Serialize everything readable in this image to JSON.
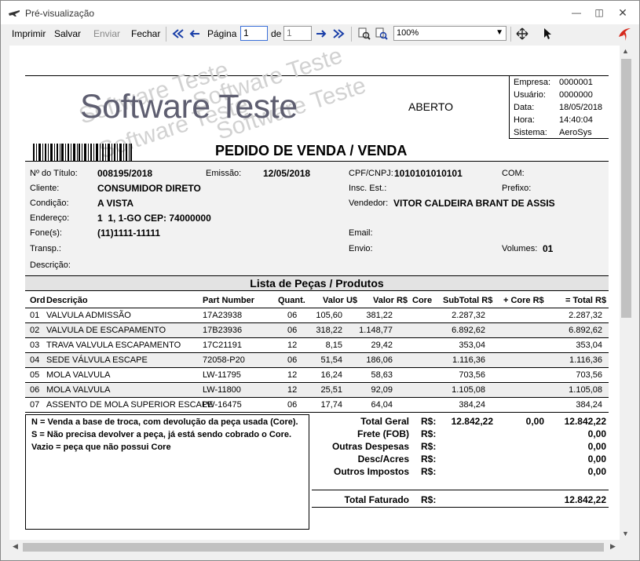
{
  "window": {
    "title": "Pré-visualização"
  },
  "toolbar": {
    "print": "Imprimir",
    "save": "Salvar",
    "send": "Enviar",
    "close": "Fechar",
    "page_label": "Página",
    "page_value": "1",
    "of_label": "de",
    "page_total": "1",
    "zoom": "100%"
  },
  "report": {
    "watermark": "Software Teste",
    "logo": "Software Teste",
    "status": "ABERTO",
    "info": [
      {
        "label": "Empresa:",
        "value": "0000001"
      },
      {
        "label": "Usuário:",
        "value": "0000000"
      },
      {
        "label": "Data:",
        "value": "18/05/2018"
      },
      {
        "label": "Hora:",
        "value": "14:40:04"
      },
      {
        "label": "Sistema:",
        "value": "AeroSys"
      }
    ],
    "title": "PEDIDO DE VENDA / VENDA",
    "fields": {
      "titulo_label": "Nº do Título:",
      "titulo": "008195/2018",
      "emissao_label": "Emissão:",
      "emissao": "12/05/2018",
      "cpf_label": "CPF/CNPJ:",
      "cpf": "1010101010101",
      "com_label": "COM:",
      "cliente_label": "Cliente:",
      "cliente": "CONSUMIDOR DIRETO",
      "insc_label": "Insc. Est.:",
      "prefixo_label": "Prefixo:",
      "condicao_label": "Condição:",
      "condicao": "A VISTA",
      "vendedor_label": "Vendedor:",
      "vendedor": "VITOR CALDEIRA BRANT DE ASSIS",
      "endereco_label": "Endereço:",
      "endereco": "1  1, 1-GO CEP: 74000000",
      "fone_label": "Fone(s):",
      "fone": "(11)1111-11111",
      "email_label": "Email:",
      "transp_label": "Transp.:",
      "envio_label": "Envio:",
      "volumes_label": "Volumes:",
      "volumes": "01",
      "descricao_label": "Descrição:"
    },
    "section_title": "Lista de Peças / Produtos",
    "columns": [
      "Ord",
      "Descrição",
      "Part Number",
      "Quant.",
      "Valor U$",
      "Valor R$",
      "Core",
      "SubTotal R$",
      "+ Core R$",
      "= Total R$"
    ],
    "rows": [
      {
        "ord": "01",
        "desc": "VALVULA ADMISSÃO",
        "pn": "17A23938",
        "qty": "06",
        "vu": "105,60",
        "vr": "381,22",
        "core": "",
        "sub": "2.287,32",
        "pcore": "",
        "total": "2.287,32"
      },
      {
        "ord": "02",
        "desc": "VALVULA DE ESCAPAMENTO",
        "pn": "17B23936",
        "qty": "06",
        "vu": "318,22",
        "vr": "1.148,77",
        "core": "",
        "sub": "6.892,62",
        "pcore": "",
        "total": "6.892,62"
      },
      {
        "ord": "03",
        "desc": "TRAVA VALVULA ESCAPAMENTO",
        "pn": "17C21191",
        "qty": "12",
        "vu": "8,15",
        "vr": "29,42",
        "core": "",
        "sub": "353,04",
        "pcore": "",
        "total": "353,04"
      },
      {
        "ord": "04",
        "desc": "SEDE VÁLVULA ESCAPE",
        "pn": "72058-P20",
        "qty": "06",
        "vu": "51,54",
        "vr": "186,06",
        "core": "",
        "sub": "1.116,36",
        "pcore": "",
        "total": "1.116,36"
      },
      {
        "ord": "05",
        "desc": "MOLA VALVULA",
        "pn": "LW-11795",
        "qty": "12",
        "vu": "16,24",
        "vr": "58,63",
        "core": "",
        "sub": "703,56",
        "pcore": "",
        "total": "703,56"
      },
      {
        "ord": "06",
        "desc": "MOLA VALVULA",
        "pn": "LW-11800",
        "qty": "12",
        "vu": "25,51",
        "vr": "92,09",
        "core": "",
        "sub": "1.105,08",
        "pcore": "",
        "total": "1.105,08"
      },
      {
        "ord": "07",
        "desc": "ASSENTO DE MOLA SUPERIOR ESCAPE",
        "pn": "LW-16475",
        "qty": "06",
        "vu": "17,74",
        "vr": "64,04",
        "core": "",
        "sub": "384,24",
        "pcore": "",
        "total": "384,24"
      }
    ],
    "legend": [
      "N = Venda a base de troca, com devolução da peça usada (Core).",
      "S = Não precisa devolver a peça, já está sendo cobrado o Core.",
      "Vazio = peça que não possui Core"
    ],
    "totals": {
      "currency": "R$:",
      "total_geral_label": "Total Geral",
      "total_geral": "12.842,22",
      "total_core": "0,00",
      "total_geral_final": "12.842,22",
      "frete_label": "Frete (FOB)",
      "frete": "0,00",
      "outras_label": "Outras Despesas",
      "outras": "0,00",
      "desc_label": "Desc/Acres",
      "desc": "0,00",
      "impostos_label": "Outros Impostos",
      "impostos": "0,00",
      "faturado_label": "Total Faturado",
      "faturado": "12.842,22"
    }
  }
}
